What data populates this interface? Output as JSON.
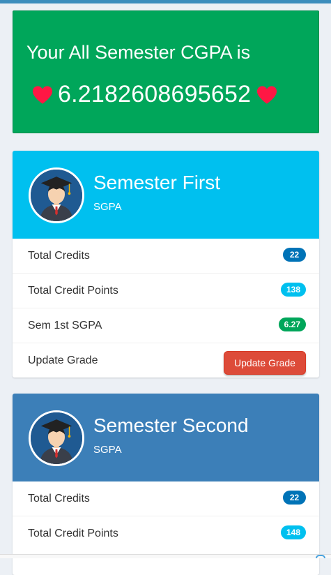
{
  "cgpa": {
    "title": "Your All Semester CGPA is",
    "value": "6.2182608695652"
  },
  "semesters": [
    {
      "title": "Semester First",
      "subtitle": "SGPA",
      "rows": [
        {
          "label": "Total Credits",
          "badge": "22"
        },
        {
          "label": "Total Credit Points",
          "badge": "138"
        },
        {
          "label": "Sem 1st SGPA",
          "badge": "6.27"
        },
        {
          "label": "Update Grade",
          "button": "Update Grade"
        }
      ]
    },
    {
      "title": "Semester Second",
      "subtitle": "SGPA",
      "rows": [
        {
          "label": "Total Credits",
          "badge": "22"
        },
        {
          "label": "Total Credit Points",
          "badge": "148"
        }
      ]
    }
  ],
  "colors": {
    "cgpa_bg": "#00a65a",
    "sem1_header": "#00c0ef",
    "sem2_header": "#3c7fb8",
    "badge_blue": "#0073b7",
    "badge_aqua": "#00c0ef",
    "badge_green": "#00a65a",
    "button_red": "#dd4b39",
    "heart": "#ff1744"
  },
  "icons": {
    "heart": "heart-icon",
    "avatar": "graduate-avatar-icon"
  }
}
